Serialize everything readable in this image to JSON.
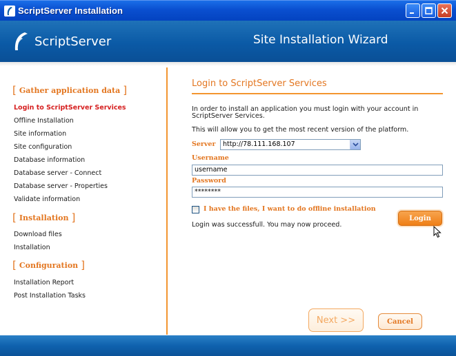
{
  "window": {
    "title": "ScriptServer Installation"
  },
  "header": {
    "logo_text": "ScriptServer",
    "wizard_title": "Site Installation Wizard"
  },
  "sidebar": {
    "sections": [
      {
        "title": "Gather application data",
        "items": [
          {
            "label": "Login to ScriptServer Services",
            "active": true
          },
          {
            "label": "Offline Installation",
            "active": false
          },
          {
            "label": "Site information",
            "active": false
          },
          {
            "label": "Site configuration",
            "active": false
          },
          {
            "label": "Database information",
            "active": false
          },
          {
            "label": "Database server - Connect",
            "active": false
          },
          {
            "label": "Database server - Properties",
            "active": false
          },
          {
            "label": "Validate information",
            "active": false
          }
        ]
      },
      {
        "title": "Installation",
        "items": [
          {
            "label": "Download files",
            "active": false
          },
          {
            "label": "Installation",
            "active": false
          }
        ]
      },
      {
        "title": "Configuration",
        "items": [
          {
            "label": "Installation Report",
            "active": false
          },
          {
            "label": "Post Installation Tasks",
            "active": false
          }
        ]
      }
    ]
  },
  "main": {
    "title": "Login to ScriptServer Services",
    "intro_line1": "In order to install an application you must login with your account in",
    "intro_line2": "ScriptServer Services.",
    "intro2": "This will allow you to get the most recent version of the platform.",
    "server_label": "Server",
    "server_value": "http://78.111.168.107",
    "username_label": "Username",
    "username_value": "username",
    "password_label": "Password",
    "password_value": "********",
    "offline_checkbox_label": "I have the files, I want to do offline installation",
    "offline_checked": false,
    "login_button": "Login",
    "status_message": "Login was successfull. You may now proceed."
  },
  "footer_buttons": {
    "next": "Next >>",
    "cancel": "Cancel"
  },
  "colors": {
    "accent": "#e37620",
    "active_item": "#d62020",
    "header_blue": "#0b5aa6"
  }
}
